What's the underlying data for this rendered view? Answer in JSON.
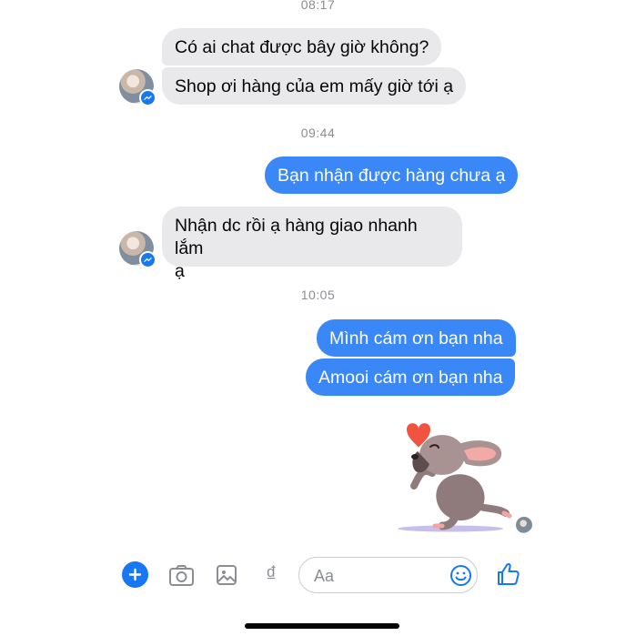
{
  "messages": {
    "ts1": "08:17",
    "m1": "Có ai chat được bây giờ không?",
    "m2": "Shop ơi hàng của em mấy giờ tới ạ",
    "ts2": "09:44",
    "m3": "Bạn nhận được hàng chưa ạ",
    "m4_line1": "Nhận dc rồi ạ hàng giao nhanh lắm",
    "m4_line2": "ạ",
    "ts3": "10:05",
    "m5": "Mình cám ơn bạn nha",
    "m6": "Amooi cám ơn bạn nha"
  },
  "sticker": {
    "name": "dog-blowing-kiss-sticker",
    "heart_color": "#f0533f"
  },
  "composer": {
    "placeholder": "Aa",
    "icons": [
      "plus-icon",
      "camera-icon",
      "image-icon",
      "currency-dong-icon",
      "emoji-icon",
      "thumbs-up-icon"
    ]
  },
  "colors": {
    "outgoing_bubble": "#3a87f7",
    "incoming_bubble": "#e9e9eb",
    "accent": "#1877f2"
  }
}
